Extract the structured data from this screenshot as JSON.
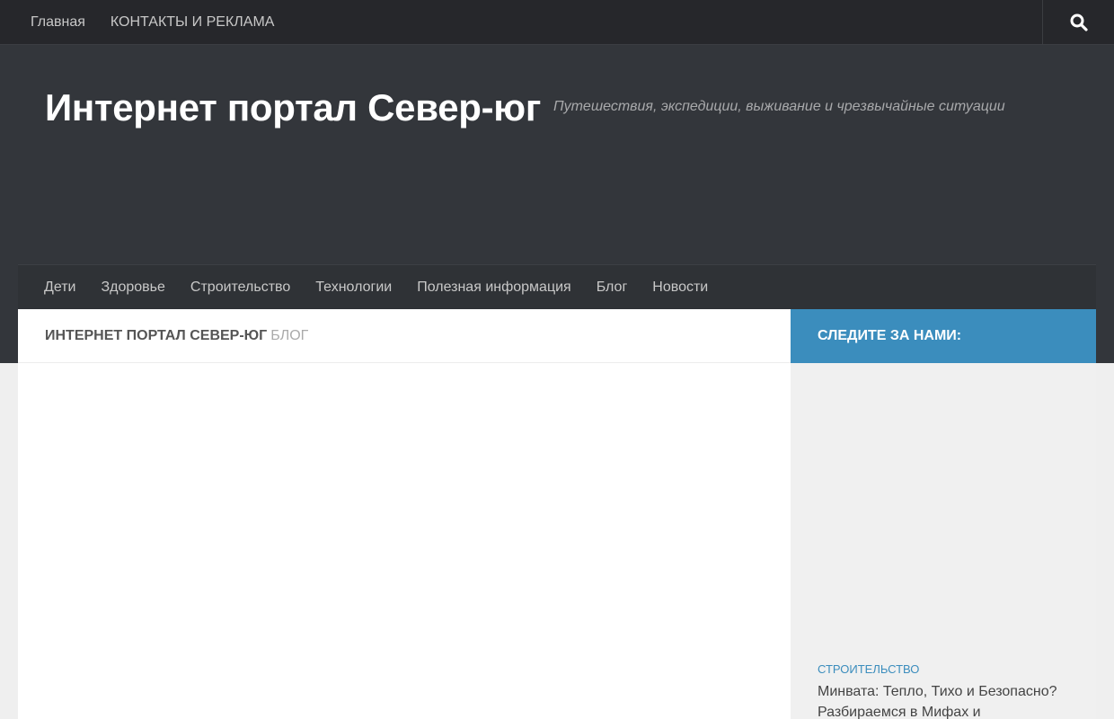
{
  "topnav": {
    "items": [
      "Главная",
      "КОНТАКТЫ И РЕКЛАМА"
    ]
  },
  "header": {
    "title": "Интернет портал Север-юг",
    "description": "Путешествия, экспедиции, выживание и чрезвычайные ситуации"
  },
  "mainnav": {
    "items": [
      "Дети",
      "Здоровье",
      "Строительство",
      "Технологии",
      "Полезная информация",
      "Блог",
      "Новости"
    ]
  },
  "content": {
    "heading_main": "Интернет портал Север-юг",
    "heading_sub": "Блог"
  },
  "sidebar": {
    "follow_title": "Следите за нами:",
    "post": {
      "category": "Строительство",
      "title": "Минвата: Тепло, Тихо и Безопасно? Разбираемся в Мифах и"
    }
  },
  "icons": {
    "search": "search-icon"
  },
  "colors": {
    "accent": "#3b8dbd",
    "topbar": "#26272b",
    "header": "#33363b"
  }
}
